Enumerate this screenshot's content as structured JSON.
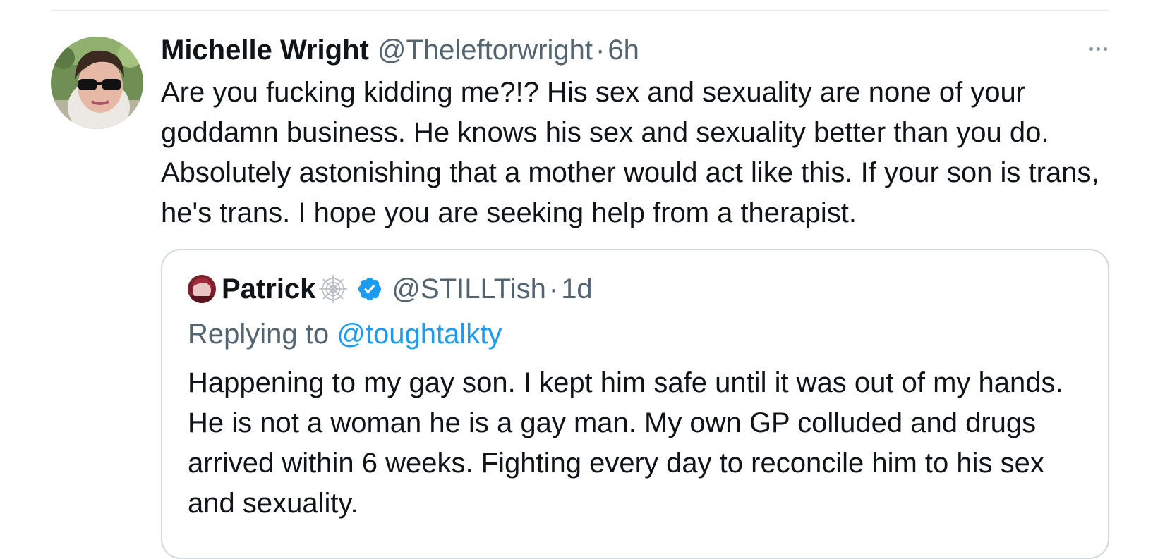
{
  "tweet": {
    "author_name": "Michelle Wright",
    "author_handle": "@Theleftorwright",
    "separator": "·",
    "timestamp": "6h",
    "text": "Are you fucking kidding me?!? His sex and sexuality are none of your goddamn business. He knows his sex and sexuality better than you do. Absolutely astonishing that a mother would act like this. If your son is trans, he's trans. I hope you are seeking help from a therapist.",
    "more_icon": "more-dots-icon"
  },
  "quoted_tweet": {
    "author_name": "Patrick",
    "author_handle": "@STILLTish",
    "separator": "·",
    "timestamp": "1d",
    "badges": [
      "spider-web-icon",
      "verified-badge-icon"
    ],
    "replying_prefix": "Replying to",
    "replying_handle": "@toughtalkty",
    "text": "Happening to my gay son. I kept him safe until it was out of my hands. He is not a woman he is a gay man.  My own GP colluded and drugs arrived within 6 weeks. Fighting every day to reconcile him to his sex and sexuality."
  },
  "colors": {
    "text_primary": "#0f1419",
    "text_secondary": "#536471",
    "link": "#1d9bf0",
    "verified": "#1d9bf0",
    "border": "#cfd9de"
  }
}
